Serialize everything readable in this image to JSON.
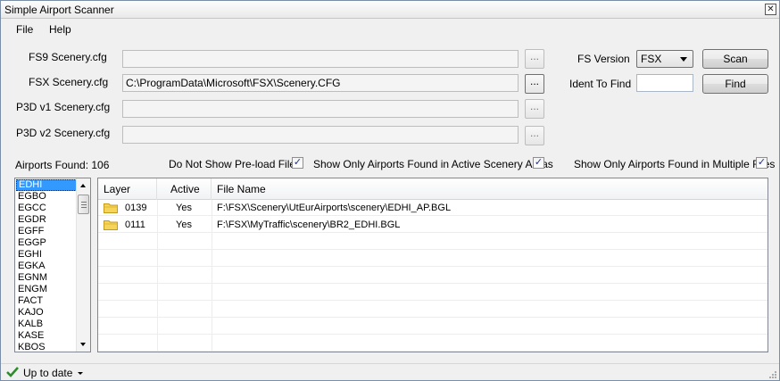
{
  "window": {
    "title": "Simple Airport Scanner"
  },
  "menu": {
    "file": "File",
    "help": "Help"
  },
  "paths": {
    "fs9": {
      "label": "FS9 Scenery.cfg",
      "value": ""
    },
    "fsx": {
      "label": "FSX Scenery.cfg",
      "value": "C:\\ProgramData\\Microsoft\\FSX\\Scenery.CFG"
    },
    "p3d1": {
      "label": "P3D v1 Scenery.cfg",
      "value": ""
    },
    "p3d2": {
      "label": "P3D v2 Scenery.cfg",
      "value": ""
    },
    "browse_label": "..."
  },
  "controls": {
    "fs_version_label": "FS Version",
    "fs_version_value": "FSX",
    "scan_label": "Scan",
    "ident_label": "Ident To Find",
    "ident_value": "",
    "find_label": "Find"
  },
  "filters": {
    "airports_found": "Airports Found: 106",
    "no_preload": "Do Not Show Pre-load Files",
    "active_only": "Show Only Airports Found in Active Scenery Areas",
    "multiple_only": "Show Only Airports Found in Multiple Files",
    "check_glyph": "✓"
  },
  "airports": [
    "EDHI",
    "EGBO",
    "EGCC",
    "EGDR",
    "EGFF",
    "EGGP",
    "EGHI",
    "EGKA",
    "EGNM",
    "ENGM",
    "FACT",
    "KAJO",
    "KALB",
    "KASE",
    "KBOS"
  ],
  "grid": {
    "columns": [
      "Layer",
      "Active",
      "File Name"
    ],
    "rows": [
      {
        "layer": "0139",
        "active": "Yes",
        "file": "F:\\FSX\\Scenery\\UtEurAirports\\scenery\\EDHI_AP.BGL"
      },
      {
        "layer": "0111",
        "active": "Yes",
        "file": "F:\\FSX\\MyTraffic\\scenery\\BR2_EDHI.BGL"
      }
    ]
  },
  "status": {
    "text": "Up to date"
  },
  "colors": {
    "selection": "#3399ff",
    "check_green": "#2e8b2e",
    "folder_yellow": "#f5d45a"
  }
}
